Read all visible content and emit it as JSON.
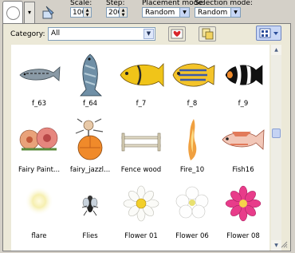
{
  "toolbar": {
    "scale_label": "Scale:",
    "scale_value": "100",
    "step_label": "Step:",
    "step_value": "200",
    "placement_label": "Placement mode:",
    "placement_value": "Random",
    "selection_label": "Selection mode:",
    "selection_value": "Random"
  },
  "panel": {
    "category_label": "Category:",
    "category_value": "All"
  },
  "items": [
    {
      "label": "f_63",
      "icon": "fish-icon"
    },
    {
      "label": "f_64",
      "icon": "fish-icon"
    },
    {
      "label": "f_7",
      "icon": "fish-icon"
    },
    {
      "label": "f_8",
      "icon": "fish-icon"
    },
    {
      "label": "f_9",
      "icon": "fish-icon"
    },
    {
      "label": "Fairy Paint...",
      "icon": "flowers-icon"
    },
    {
      "label": "fairy_jazzl...",
      "icon": "fairy-icon"
    },
    {
      "label": "Fence wood",
      "icon": "fence-icon"
    },
    {
      "label": "Fire_10",
      "icon": "flame-icon"
    },
    {
      "label": "Fish16",
      "icon": "fish-icon"
    },
    {
      "label": "flare",
      "icon": "flare-icon"
    },
    {
      "label": "Flies",
      "icon": "fly-icon"
    },
    {
      "label": "Flower 01",
      "icon": "flower-icon"
    },
    {
      "label": "Flower 06",
      "icon": "flower-icon"
    },
    {
      "label": "Flower 08",
      "icon": "flower-icon"
    }
  ]
}
